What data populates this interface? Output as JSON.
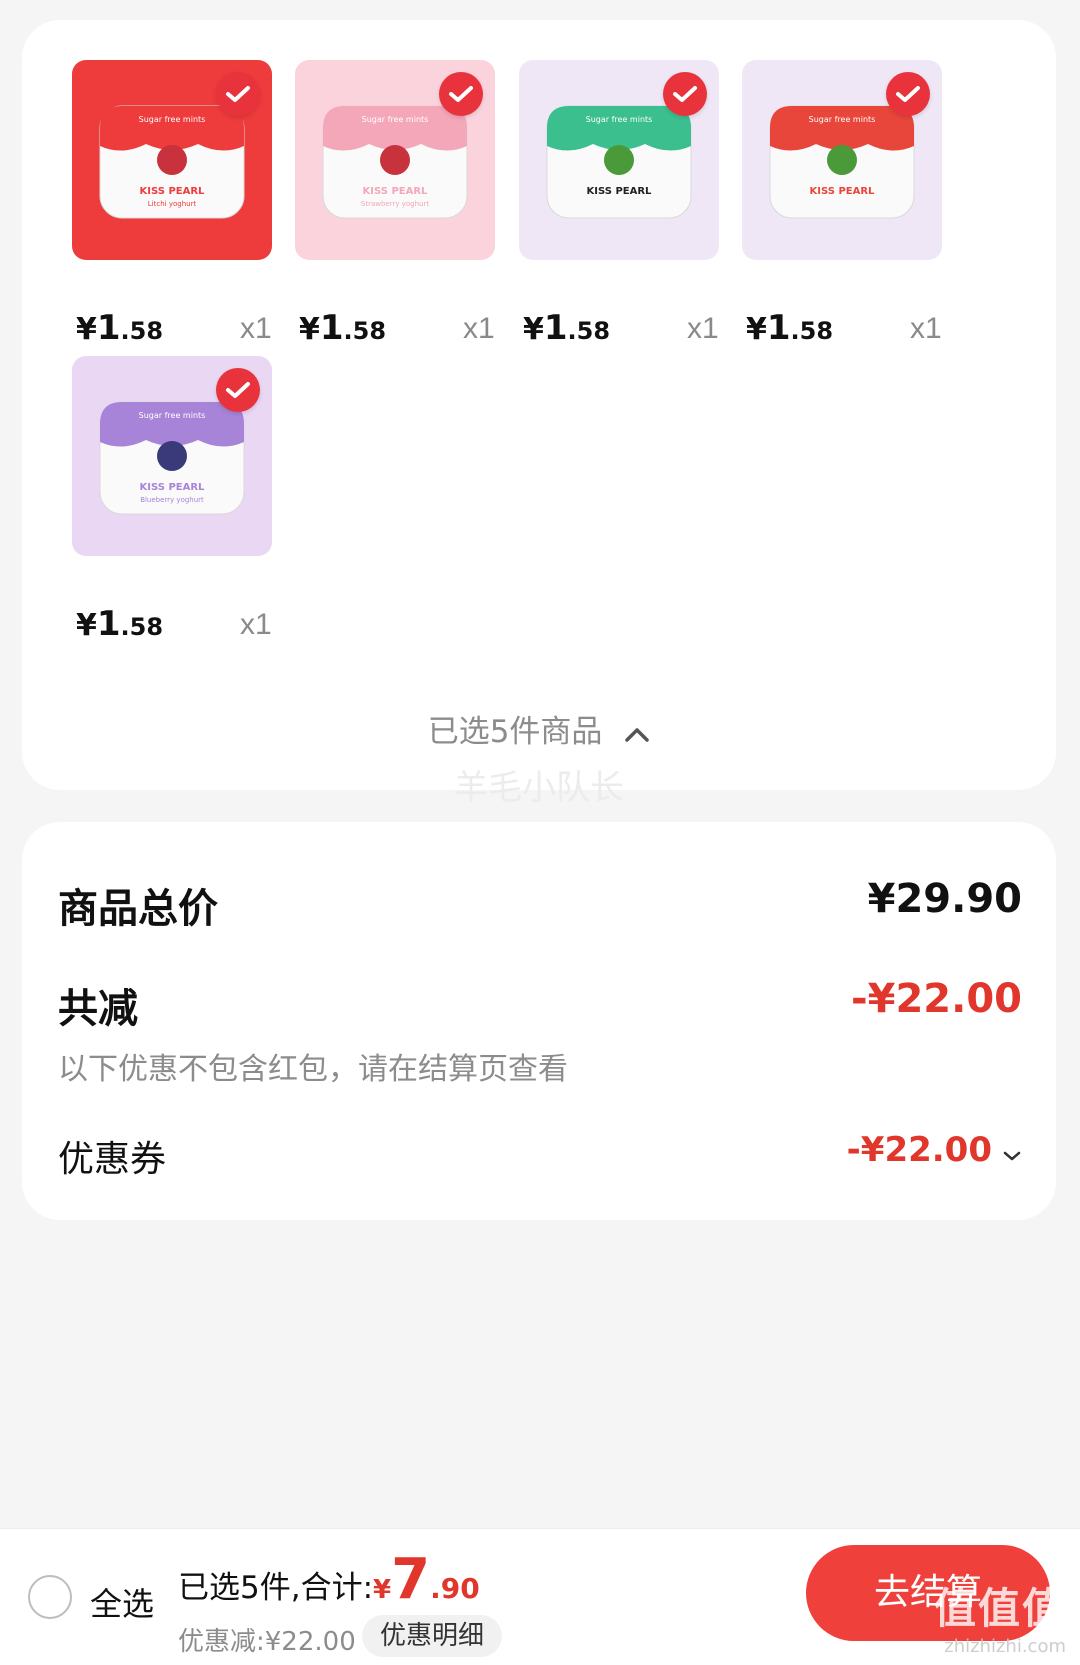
{
  "colors": {
    "accent_red": "#e0362b",
    "checkout_red": "#f0403b",
    "check_badge": "#e8323c"
  },
  "products": [
    {
      "name_on_pack": "KISS PEARL",
      "tagline": "Sugar free mints",
      "flavor": "Litchi yoghurt",
      "theme": "#ee3b3b",
      "price_symbol": "¥",
      "price_int": "1",
      "price_dec": ".58",
      "qty": "x1",
      "selected": true
    },
    {
      "name_on_pack": "KISS PEARL",
      "tagline": "Sugar free mints",
      "flavor": "Strawberry yoghurt",
      "theme": "#f4a7b9",
      "price_symbol": "¥",
      "price_int": "1",
      "price_dec": ".58",
      "qty": "x1",
      "selected": true
    },
    {
      "name_on_pack": "KISS PEARL",
      "tagline": "Sugar free mints",
      "flavor": "",
      "theme": "#3cbf8f",
      "price_symbol": "¥",
      "price_int": "1",
      "price_dec": ".58",
      "qty": "x1",
      "selected": true
    },
    {
      "name_on_pack": "KISS PEARL",
      "tagline": "Sugar free mints",
      "flavor": "",
      "theme": "#e8463b",
      "price_symbol": "¥",
      "price_int": "1",
      "price_dec": ".58",
      "qty": "x1",
      "selected": true
    },
    {
      "name_on_pack": "KISS PEARL",
      "tagline": "Sugar free mints",
      "flavor": "Blueberry yoghurt",
      "theme": "#a784d8",
      "price_symbol": "¥",
      "price_int": "1",
      "price_dec": ".58",
      "qty": "x1",
      "selected": true
    }
  ],
  "selection": {
    "collapse_label": "已选5件商品",
    "watermark": "羊毛小队长"
  },
  "summary": {
    "total_label": "商品总价",
    "total_value": "¥29.90",
    "reduce_label": "共减",
    "reduce_value": "-¥22.00",
    "note": "以下优惠不包含红包，请在结算页查看",
    "coupon_label": "优惠券",
    "coupon_value": "-¥22.00"
  },
  "bottom_bar": {
    "select_all": "全选",
    "selected_prefix": "已选5件,合计:",
    "total_symbol": "¥",
    "total_int": "7",
    "total_dec": ".90",
    "discount_text": "优惠减:¥22.00",
    "discount_detail": "优惠明细",
    "checkout": "去结算",
    "site_mark": "值值值",
    "site_url": "zhizhizhi.com"
  }
}
